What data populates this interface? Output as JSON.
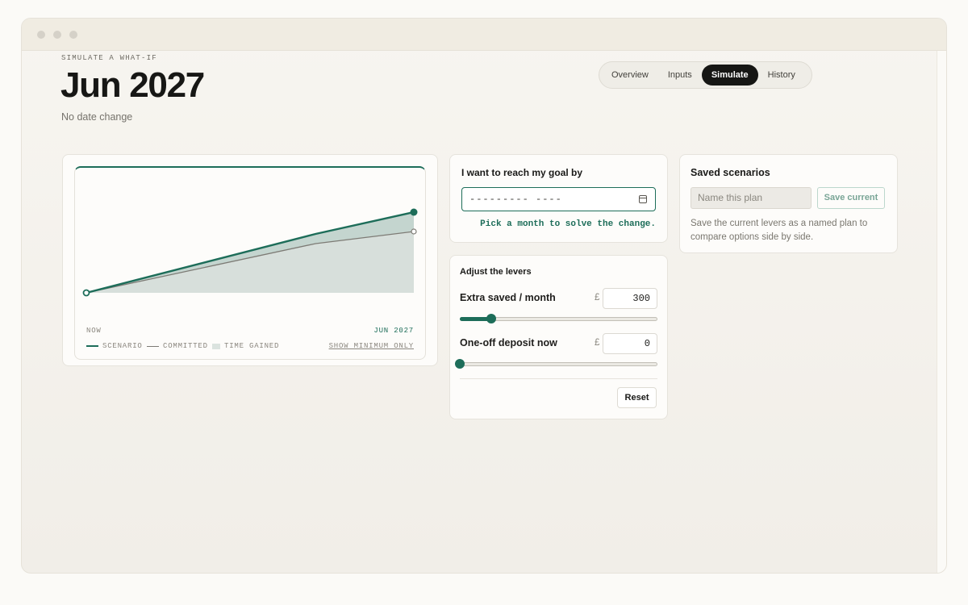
{
  "page": {
    "eyebrow": "SIMULATE A WHAT-IF",
    "title": "Jun 2027",
    "subtitle": "No date change"
  },
  "tabs": [
    {
      "label": "Overview",
      "active": false
    },
    {
      "label": "Inputs",
      "active": false
    },
    {
      "label": "Simulate",
      "active": true
    },
    {
      "label": "History",
      "active": false
    }
  ],
  "chart": {
    "start_label": "NOW",
    "end_label": "JUN 2027",
    "legend": {
      "scenario": "SCENARIO",
      "committed": "COMMITTED",
      "time_gained": "TIME GAINED",
      "show_minimum": "SHOW MINIMUM ONLY"
    }
  },
  "chart_data": {
    "type": "line",
    "x": [
      0,
      0.7,
      1
    ],
    "series": [
      {
        "name": "SCENARIO",
        "values": [
          0,
          0.73,
          1.0
        ]
      },
      {
        "name": "COMMITTED",
        "values": [
          0,
          0.61,
          0.76
        ]
      }
    ],
    "x_labels": [
      "NOW",
      "JUN 2027"
    ],
    "ylim": [
      0,
      1.45
    ],
    "colors": {
      "scenario": "#1d6d59",
      "committed": "#7d7b75",
      "time_gained": "#dbe3df"
    }
  },
  "goal": {
    "title": "I want to reach my goal by",
    "date_placeholder": "---------  ----",
    "hint": "Pick a month to solve the change."
  },
  "levers": {
    "title": "Adjust the levers",
    "extra": {
      "label": "Extra saved / month",
      "currency": "£",
      "value": "300",
      "fraction": 0.16
    },
    "deposit": {
      "label": "One-off deposit now",
      "currency": "£",
      "value": "0",
      "fraction": 0
    },
    "reset_label": "Reset"
  },
  "saved": {
    "title": "Saved scenarios",
    "name_placeholder": "Name this plan",
    "save_label": "Save current",
    "description": "Save the current levers as a named plan to compare options side by side."
  },
  "colors": {
    "accent": "#1d6d59",
    "tab_active_bg": "#161614"
  }
}
